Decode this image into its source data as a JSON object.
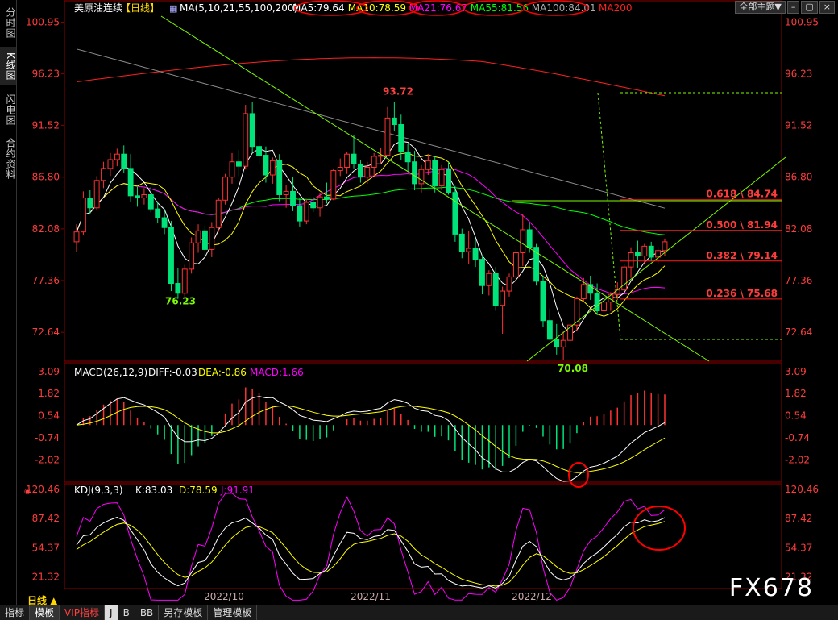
{
  "sidebar": {
    "items": [
      {
        "label": "分时图",
        "active": false
      },
      {
        "label": "K线图",
        "active": true
      },
      {
        "label": "闪电图",
        "active": false
      },
      {
        "label": "合约资料",
        "active": false
      }
    ]
  },
  "header": {
    "title": "美原油连续",
    "period": "【日线】",
    "ma_label": "MA(5,10,21,55,100,200)",
    "ma_values": [
      {
        "text": "MA5:79.64",
        "color": "#ffffff"
      },
      {
        "text": "MA10:78.59",
        "color": "#ffff00"
      },
      {
        "text": "MA21:76.67",
        "color": "#ff00ff"
      },
      {
        "text": "MA55:81.56",
        "color": "#00ff00"
      },
      {
        "text": "MA100:84.01",
        "color": "#aaaaaa"
      },
      {
        "text": "MA200",
        "color": "#ff2020"
      }
    ],
    "theme_button": "全部主题▼"
  },
  "macd_header": {
    "label": "MACD(26,12,9)",
    "diff": "DIFF:-0.03",
    "dea": "DEA:-0.86",
    "macd": "MACD:1.66"
  },
  "kdj_header": {
    "label": "KDJ(9,3,3)",
    "k": "K:83.03",
    "d": "D:78.59",
    "j": "J:91.91"
  },
  "bottom_bar": {
    "period": "日线 ▲",
    "tabs": [
      "指标",
      "模板",
      "VIP指标",
      "J",
      "B",
      "BB",
      "另存模板",
      "管理模板"
    ]
  },
  "watermark": "FX678",
  "colors": {
    "up": "#ff3232",
    "down": "#00e37a",
    "ma5": "#ffffff",
    "ma10": "#ffff00",
    "ma21": "#ff00ff",
    "ma55": "#00ff00",
    "ma100": "#8c8c8c",
    "ma200": "#ff2020",
    "axis_text": "#ff3c3c",
    "trend": "#7cfc00"
  },
  "chart_data": [
    {
      "type": "candlestick",
      "title": "美原油连续",
      "ylim": [
        70.0,
        101.5
      ],
      "y_ticks": [
        100.95,
        96.23,
        91.52,
        86.8,
        82.08,
        77.36,
        72.64
      ],
      "x_ticks": [
        "2022/10",
        "2022/11",
        "2022/12"
      ],
      "annotations": [
        {
          "text": "93.72",
          "value": 93.72
        },
        {
          "text": "76.23",
          "value": 76.23
        },
        {
          "text": "70.08",
          "value": 70.08
        }
      ],
      "fibonacci": [
        {
          "ratio": "0.618",
          "value": 84.74,
          "label": "0.618 \\ 84.74"
        },
        {
          "ratio": "0.500",
          "value": 81.94,
          "label": "0.500 \\ 81.94"
        },
        {
          "ratio": "0.382",
          "value": 79.14,
          "label": "0.382 \\ 79.14"
        },
        {
          "ratio": "0.236",
          "value": 75.68,
          "label": "0.236 \\ 75.68"
        }
      ],
      "candles": [
        [
          80.9,
          82.5,
          80.0,
          81.8
        ],
        [
          81.8,
          85.5,
          81.5,
          84.9
        ],
        [
          84.9,
          85.6,
          83.4,
          84.0
        ],
        [
          84.0,
          86.9,
          83.8,
          86.5
        ],
        [
          86.5,
          88.2,
          85.8,
          87.6
        ],
        [
          87.6,
          89.0,
          86.9,
          88.4
        ],
        [
          88.4,
          89.4,
          87.8,
          88.9
        ],
        [
          88.9,
          89.7,
          87.2,
          87.6
        ],
        [
          87.6,
          88.9,
          84.5,
          85.1
        ],
        [
          85.1,
          85.9,
          84.1,
          84.9
        ],
        [
          84.9,
          85.8,
          84.3,
          85.2
        ],
        [
          85.2,
          85.9,
          83.6,
          83.9
        ],
        [
          83.9,
          84.6,
          82.6,
          83.1
        ],
        [
          83.1,
          83.8,
          81.6,
          82.2
        ],
        [
          82.2,
          82.8,
          76.4,
          77.1
        ],
        [
          77.1,
          78.5,
          75.7,
          76.2
        ],
        [
          76.2,
          78.8,
          75.9,
          78.4
        ],
        [
          78.4,
          81.3,
          78.0,
          80.8
        ],
        [
          80.8,
          82.5,
          79.9,
          81.9
        ],
        [
          81.9,
          82.4,
          79.6,
          80.2
        ],
        [
          80.2,
          82.7,
          79.5,
          82.2
        ],
        [
          82.2,
          84.9,
          81.8,
          84.7
        ],
        [
          84.7,
          87.1,
          84.3,
          86.8
        ],
        [
          86.8,
          89.0,
          86.2,
          88.2
        ],
        [
          88.2,
          89.3,
          86.9,
          87.8
        ],
        [
          87.8,
          93.4,
          87.5,
          92.6
        ],
        [
          92.6,
          93.7,
          89.0,
          89.6
        ],
        [
          89.6,
          90.4,
          88.0,
          88.8
        ],
        [
          88.8,
          89.6,
          86.3,
          87.0
        ],
        [
          87.0,
          88.6,
          86.2,
          88.3
        ],
        [
          88.3,
          88.9,
          84.6,
          85.2
        ],
        [
          85.2,
          86.1,
          84.0,
          85.5
        ],
        [
          85.5,
          86.8,
          83.7,
          84.2
        ],
        [
          84.2,
          84.9,
          82.3,
          82.8
        ],
        [
          82.8,
          84.8,
          82.5,
          84.5
        ],
        [
          84.5,
          85.0,
          83.6,
          84.0
        ],
        [
          84.0,
          85.3,
          83.2,
          85.0
        ],
        [
          85.0,
          86.3,
          84.4,
          84.8
        ],
        [
          84.8,
          87.6,
          84.7,
          87.4
        ],
        [
          87.4,
          88.5,
          86.9,
          87.7
        ],
        [
          87.7,
          89.1,
          87.1,
          88.9
        ],
        [
          88.9,
          90.6,
          87.6,
          88.0
        ],
        [
          88.0,
          88.4,
          86.3,
          86.8
        ],
        [
          86.8,
          88.2,
          86.2,
          87.7
        ],
        [
          87.7,
          89.0,
          86.9,
          88.7
        ],
        [
          88.7,
          89.5,
          88.0,
          88.8
        ],
        [
          88.8,
          93.2,
          88.7,
          92.2
        ],
        [
          92.2,
          93.7,
          91.0,
          91.6
        ],
        [
          91.6,
          92.5,
          88.4,
          89.1
        ],
        [
          89.1,
          89.8,
          87.3,
          88.2
        ],
        [
          88.2,
          89.2,
          85.6,
          86.2
        ],
        [
          86.2,
          87.9,
          85.4,
          87.5
        ],
        [
          87.5,
          88.9,
          87.0,
          88.3
        ],
        [
          88.3,
          88.7,
          85.4,
          86.0
        ],
        [
          86.0,
          87.9,
          85.6,
          87.5
        ],
        [
          87.5,
          88.2,
          85.2,
          85.4
        ],
        [
          85.4,
          86.0,
          80.9,
          81.6
        ],
        [
          81.6,
          82.1,
          79.4,
          80.0
        ],
        [
          80.0,
          81.9,
          78.9,
          80.3
        ],
        [
          80.3,
          81.1,
          78.6,
          79.3
        ],
        [
          79.3,
          79.7,
          76.1,
          76.9
        ],
        [
          76.9,
          78.3,
          76.0,
          78.0
        ],
        [
          78.0,
          78.6,
          74.6,
          75.1
        ],
        [
          75.1,
          76.8,
          72.5,
          76.4
        ],
        [
          76.4,
          78.0,
          75.9,
          77.7
        ],
        [
          77.7,
          80.2,
          77.1,
          79.9
        ],
        [
          79.9,
          83.4,
          78.7,
          82.0
        ],
        [
          82.0,
          82.6,
          79.9,
          80.4
        ],
        [
          80.4,
          80.7,
          76.9,
          77.3
        ],
        [
          77.3,
          77.8,
          73.1,
          73.7
        ],
        [
          73.7,
          74.8,
          71.9,
          72.0
        ],
        [
          72.0,
          73.4,
          70.6,
          71.3
        ],
        [
          71.3,
          72.7,
          70.1,
          71.9
        ],
        [
          71.9,
          73.6,
          71.5,
          73.3
        ],
        [
          73.3,
          75.9,
          72.8,
          75.7
        ],
        [
          75.7,
          77.6,
          75.5,
          77.0
        ],
        [
          77.0,
          77.8,
          75.6,
          76.2
        ],
        [
          76.2,
          77.1,
          74.2,
          74.6
        ],
        [
          74.6,
          76.1,
          73.8,
          75.4
        ],
        [
          75.4,
          76.3,
          74.6,
          76.1
        ],
        [
          76.1,
          77.2,
          75.6,
          76.5
        ],
        [
          76.5,
          78.9,
          76.2,
          78.6
        ],
        [
          78.6,
          80.4,
          77.6,
          79.9
        ],
        [
          79.9,
          81.0,
          78.5,
          79.6
        ],
        [
          79.6,
          80.7,
          78.9,
          80.5
        ],
        [
          80.5,
          80.9,
          79.1,
          79.5
        ],
        [
          79.5,
          80.4,
          78.9,
          80.1
        ],
        [
          80.1,
          81.2,
          79.6,
          80.9
        ]
      ]
    },
    {
      "type": "bar",
      "title": "MACD(26,12,9)",
      "ylim": [
        -3.2,
        3.5
      ],
      "y_ticks": [
        3.09,
        1.82,
        0.54,
        -0.74,
        -2.02
      ],
      "diff": -0.03,
      "dea": -0.86,
      "macd": 1.66
    },
    {
      "type": "line",
      "title": "KDJ(9,3,3)",
      "ylim": [
        10,
        125
      ],
      "y_ticks": [
        120.46,
        87.42,
        54.37,
        21.32
      ],
      "k": 83.03,
      "d": 78.59,
      "j": 91.91
    }
  ]
}
